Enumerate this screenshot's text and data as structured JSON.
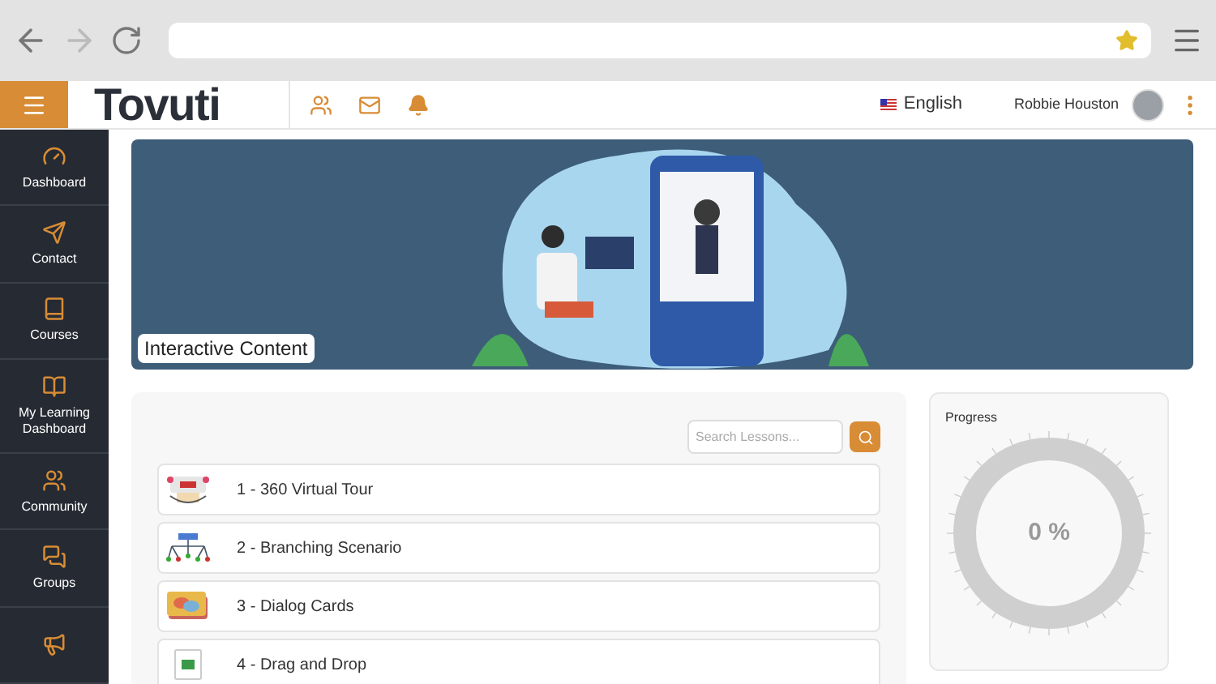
{
  "header": {
    "logo": "Tovuti",
    "language": "English",
    "user_name": "Robbie Houston"
  },
  "sidebar": {
    "items": [
      {
        "label": "Dashboard",
        "selected": false
      },
      {
        "label": "Contact",
        "selected": false
      },
      {
        "label": "Courses",
        "selected": false
      },
      {
        "label": "My Learning Dashboard",
        "selected": false
      },
      {
        "label": "Community",
        "selected": false
      },
      {
        "label": "Groups",
        "selected": false
      },
      {
        "selected": false
      }
    ]
  },
  "banner": {
    "title": "Interactive Content"
  },
  "lessons": {
    "search": {
      "placeholder": "Search Lessons..."
    },
    "items": [
      {
        "title": "1 - 360 Virtual Tour"
      },
      {
        "title": "2 - Branching Scenario"
      },
      {
        "title": "3 - Dialog Cards"
      },
      {
        "title": "4 - Drag and Drop"
      }
    ]
  },
  "progress": {
    "title": "Progress",
    "level": 0,
    "reading": "0 %"
  }
}
